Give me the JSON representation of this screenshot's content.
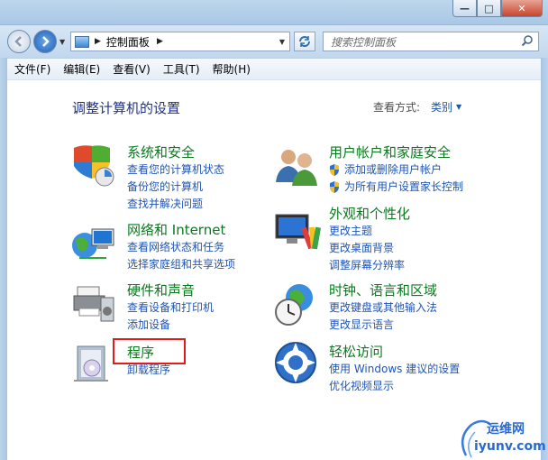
{
  "window": {
    "controls": {
      "minimize": "—",
      "maximize": "□",
      "close": "✕"
    }
  },
  "address": {
    "crumb": "控制面板",
    "search_placeholder": "搜索控制面板"
  },
  "menu": [
    "文件(F)",
    "编辑(E)",
    "查看(V)",
    "工具(T)",
    "帮助(H)"
  ],
  "main": {
    "heading": "调整计算机的设置",
    "view_by_label": "查看方式:",
    "view_by_value": "类别"
  },
  "categories": {
    "system": {
      "title": "系统和安全",
      "links": [
        "查看您的计算机状态",
        "备份您的计算机",
        "查找并解决问题"
      ]
    },
    "network": {
      "title": "网络和 Internet",
      "links": [
        "查看网络状态和任务",
        "选择家庭组和共享选项"
      ]
    },
    "hardware": {
      "title": "硬件和声音",
      "links": [
        "查看设备和打印机",
        "添加设备"
      ]
    },
    "programs": {
      "title": "程序",
      "links": [
        "卸载程序"
      ]
    },
    "users": {
      "title": "用户帐户和家庭安全",
      "links": [
        "添加或删除用户帐户",
        "为所有用户设置家长控制"
      ]
    },
    "appearance": {
      "title": "外观和个性化",
      "links": [
        "更改主题",
        "更改桌面背景",
        "调整屏幕分辨率"
      ]
    },
    "clock": {
      "title": "时钟、语言和区域",
      "links": [
        "更改键盘或其他输入法",
        "更改显示语言"
      ]
    },
    "ease": {
      "title": "轻松访问",
      "links": [
        "使用 Windows 建议的设置",
        "优化视频显示"
      ]
    }
  },
  "watermark": {
    "line1": "运维网",
    "line2": "iyunv.com"
  },
  "colors": {
    "title_green": "#0a7a1e",
    "link_blue": "#1f55b5",
    "heading_blue": "#1e3287",
    "highlight_red": "#e11b1b"
  }
}
